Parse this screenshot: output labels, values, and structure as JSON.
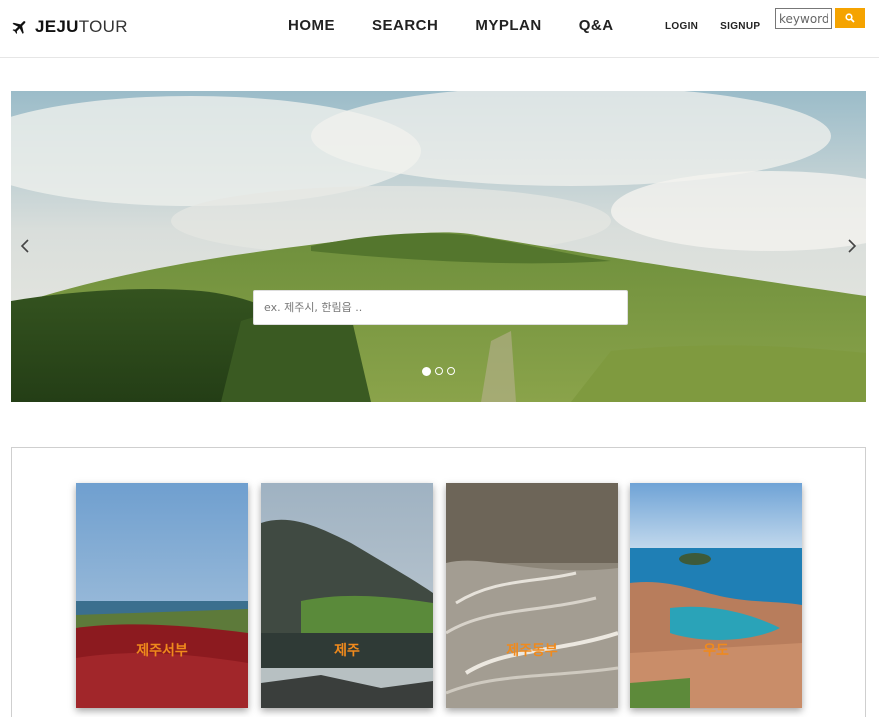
{
  "brand": {
    "bold": "JEJU",
    "light": "TOUR",
    "icon": "airplane-icon"
  },
  "nav": {
    "items": [
      "HOME",
      "SEARCH",
      "MYPLAN",
      "Q&A"
    ]
  },
  "auth": {
    "login": "LOGIN",
    "signup": "SIGNUP"
  },
  "header_search": {
    "placeholder": "keyword",
    "button_icon": "search-icon"
  },
  "hero": {
    "search_placeholder": "ex. 제주시, 한림읍 ..",
    "slide_count": 3,
    "active_slide": 1,
    "prev_icon": "chevron-left-icon",
    "next_icon": "chevron-right-icon"
  },
  "regions": {
    "cards": [
      "제주서부",
      "제주",
      "제주동부",
      "우도"
    ]
  },
  "colors": {
    "accent": "#f5a300",
    "card_label": "#f08a1c",
    "text": "#222222"
  }
}
